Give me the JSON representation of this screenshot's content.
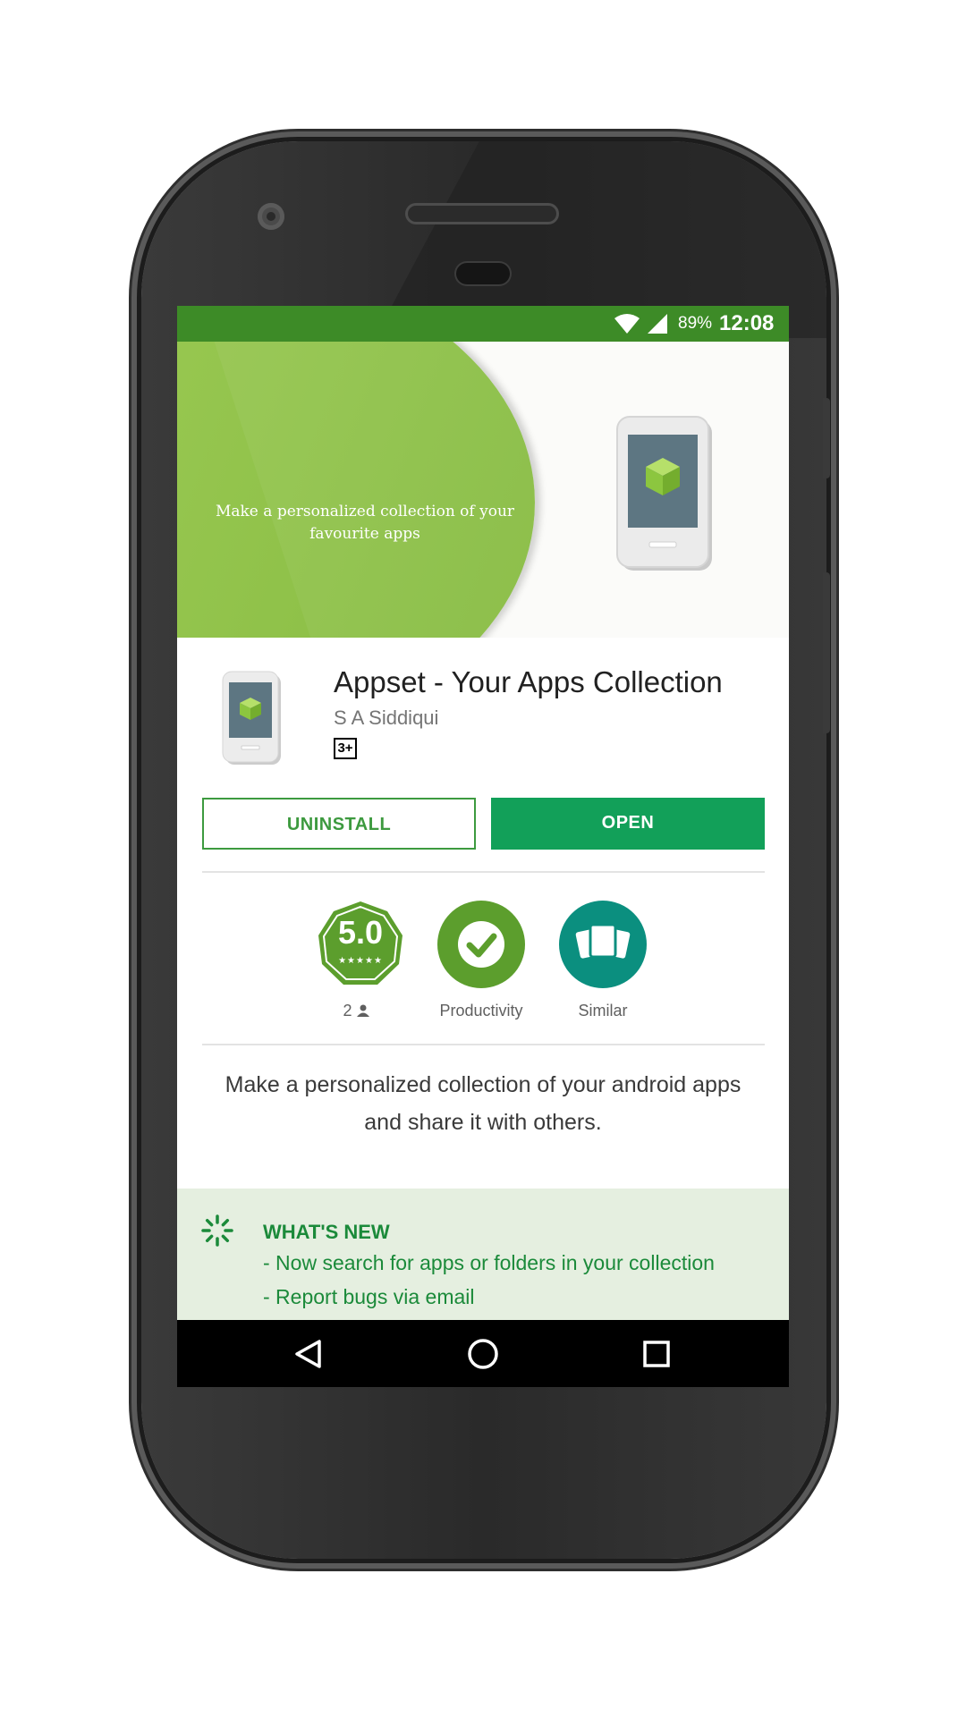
{
  "status_bar": {
    "battery": "89%",
    "time": "12:08"
  },
  "banner": {
    "tagline": "Make a personalized collection of your favourite apps"
  },
  "app": {
    "title": "Appset - Your Apps Collection",
    "developer": "S A Siddiqui",
    "content_rating": "3+"
  },
  "actions": {
    "uninstall_label": "UNINSTALL",
    "open_label": "OPEN"
  },
  "badges": {
    "rating": "5.0",
    "rating_stars": "★★★★★",
    "rating_count": "2",
    "category": "Productivity",
    "similar": "Similar"
  },
  "description": "Make a personalized collection of your android apps and share it with others.",
  "whats_new": {
    "title": "WHAT'S NEW",
    "items": [
      "- Now search for apps or folders in your collection",
      "- Report bugs via email"
    ]
  },
  "colors": {
    "status_bar": "#3d8b27",
    "open_button": "#12a059",
    "accent_green": "#3d9a3f",
    "similar_teal": "#0b8f7f"
  },
  "icons": [
    "wifi-icon",
    "signal-icon",
    "rating-badge-icon",
    "check-circle-icon",
    "similar-cards-icon",
    "person-icon",
    "loading-spinner-icon",
    "back-icon",
    "home-icon",
    "recents-icon"
  ]
}
